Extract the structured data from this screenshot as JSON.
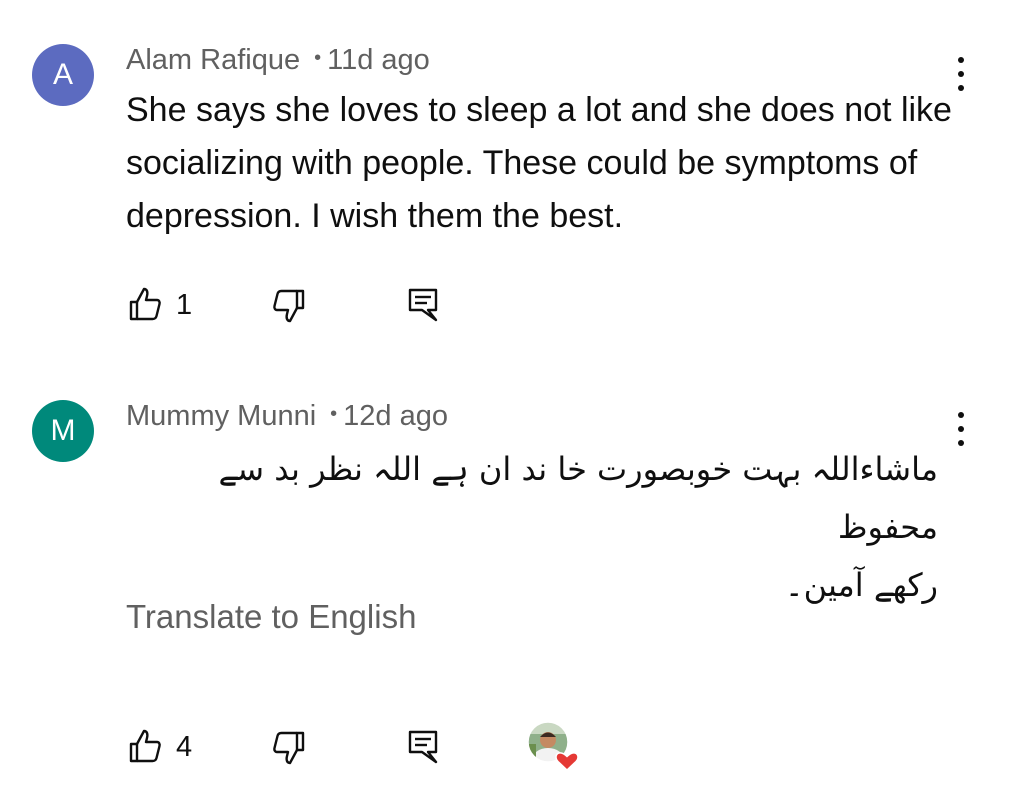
{
  "comments": [
    {
      "avatar_letter": "A",
      "avatar_color": "#5c6bc0",
      "author": "Alam  Rafique",
      "separator": "•",
      "time": "11d ago",
      "text": "She says she loves to sleep a lot and she does not like socializing with people. These could be symptoms of depression. I wish them the best.",
      "likes": "1"
    },
    {
      "avatar_letter": "M",
      "avatar_color": "#00897b",
      "author": "Mummy Munni",
      "separator": "•",
      "time": "12d ago",
      "text_lines": [
        "ماشاءاللہ بہت خوبصورت خا ند ان ہے اللہ  نظر بد سے محفوظ",
        "رکھے آمین۔"
      ],
      "translate_label": "Translate to English",
      "likes": "4"
    }
  ],
  "icons": {
    "like": "thumbs-up-icon",
    "dislike": "thumbs-down-icon",
    "reply": "reply-icon",
    "more": "more-vert-icon",
    "heart": "creator-heart-icon"
  },
  "colors": {
    "text": "#0f0f0f",
    "secondary": "#606060",
    "heart": "#e53935"
  }
}
